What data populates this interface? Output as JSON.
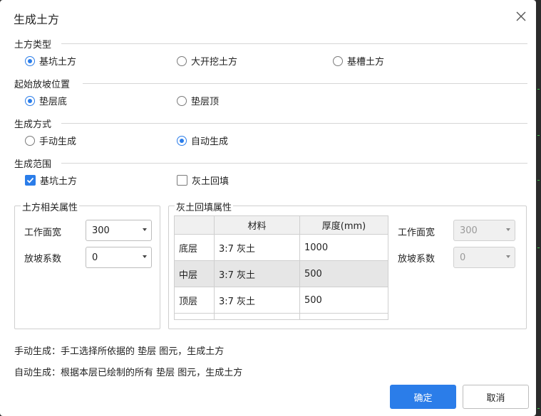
{
  "dialog": {
    "title": "生成土方",
    "close_icon": "close-icon"
  },
  "earthwork_type": {
    "label": "土方类型",
    "options": [
      {
        "label": "基坑土方",
        "checked": true
      },
      {
        "label": "大开挖土方",
        "checked": false
      },
      {
        "label": "基槽土方",
        "checked": false
      }
    ]
  },
  "slope_start": {
    "label": "起始放坡位置",
    "options": [
      {
        "label": "垫层底",
        "checked": true
      },
      {
        "label": "垫层顶",
        "checked": false
      }
    ]
  },
  "generate_mode": {
    "label": "生成方式",
    "options": [
      {
        "label": "手动生成",
        "checked": false
      },
      {
        "label": "自动生成",
        "checked": true
      }
    ]
  },
  "generate_scope": {
    "label": "生成范围",
    "options": [
      {
        "label": "基坑土方",
        "checked": true
      },
      {
        "label": "灰土回填",
        "checked": false
      }
    ]
  },
  "earth_props": {
    "legend": "土方相关属性",
    "work_width_label": "工作面宽",
    "work_width_value": "300",
    "slope_coef_label": "放坡系数",
    "slope_coef_value": "0"
  },
  "backfill_props": {
    "legend": "灰土回填属性",
    "table": {
      "headers": [
        "",
        "材料",
        "厚度(mm)"
      ],
      "rows": [
        {
          "name": "底层",
          "material": "3:7 灰土",
          "thickness": "1000"
        },
        {
          "name": "中层",
          "material": "3:7 灰土",
          "thickness": "500"
        },
        {
          "name": "顶层",
          "material": "3:7 灰土",
          "thickness": "500"
        }
      ]
    },
    "work_width_label": "工作面宽",
    "work_width_value": "300",
    "slope_coef_label": "放坡系数",
    "slope_coef_value": "0"
  },
  "notes": {
    "manual": "手动生成：手工选择所依据的 垫层 图元，生成土方",
    "auto": "自动生成：根据本层已绘制的所有 垫层 图元，生成土方"
  },
  "buttons": {
    "ok": "确定",
    "cancel": "取消"
  },
  "colors": {
    "accent": "#2b7de9"
  }
}
